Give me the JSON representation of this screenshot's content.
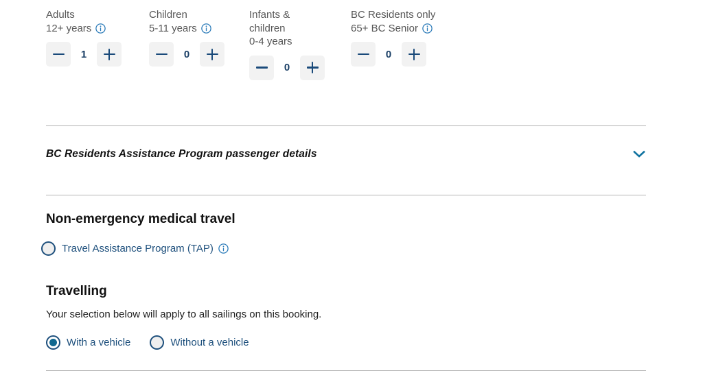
{
  "colors": {
    "accent_blue": "#11688f",
    "navy": "#1d4f7c",
    "label_gray": "#575757",
    "divider": "#b3b3b3",
    "stepper_bg": "#f2f2f2",
    "chevron": "#1073a0"
  },
  "passengers": {
    "columns": [
      {
        "key": "adults",
        "label_lines": [
          "Adults",
          "12+ years"
        ],
        "info_icon": "info-circle-icon",
        "value": "1",
        "decrement_label": "minus-icon",
        "increment_label": "plus-icon"
      },
      {
        "key": "children",
        "label_lines": [
          "Children",
          "5-11 years"
        ],
        "info_icon": "info-circle-icon",
        "value": "0",
        "decrement_label": "minus-icon",
        "increment_label": "plus-icon"
      },
      {
        "key": "infants",
        "label_lines": [
          "Infants &",
          "children",
          "0-4 years"
        ],
        "info_icon": null,
        "value": "0",
        "decrement_label": "minus-icon",
        "increment_label": "plus-icon"
      },
      {
        "key": "bc-senior",
        "label_lines": [
          "BC Residents only",
          "65+ BC Senior"
        ],
        "info_icon": "info-circle-icon",
        "value": "0",
        "decrement_label": "minus-icon",
        "increment_label": "plus-icon"
      }
    ]
  },
  "assistance_program": {
    "title": "BC Residents Assistance Program passenger details",
    "toggle_icon": "chevron-down-icon",
    "expanded": false
  },
  "medical_travel": {
    "heading": "Non-emergency medical travel",
    "option": {
      "label": "Travel Assistance Program (TAP)",
      "selected": false,
      "info_icon": "info-circle-icon"
    }
  },
  "travelling": {
    "heading": "Travelling",
    "description": "Your selection below will apply to all sailings on this booking.",
    "options": [
      {
        "label": "With a vehicle",
        "selected": true
      },
      {
        "label": "Without a vehicle",
        "selected": false
      }
    ]
  }
}
